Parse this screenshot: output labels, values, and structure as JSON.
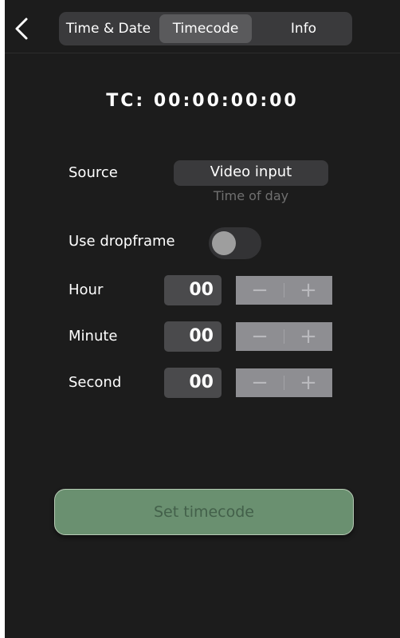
{
  "nav": {
    "back_icon": "chevron-left-icon",
    "tabs": [
      {
        "label": "Time & Date",
        "selected": false
      },
      {
        "label": "Timecode",
        "selected": true
      },
      {
        "label": "Info",
        "selected": false
      }
    ]
  },
  "timecode": {
    "prefix": "TC:",
    "value": "00:00:00:00"
  },
  "source": {
    "label": "Source",
    "options": [
      "Video input",
      "Time of day"
    ],
    "selected": "Video input"
  },
  "dropframe": {
    "label": "Use dropframe",
    "enabled": false
  },
  "fields": [
    {
      "label": "Hour",
      "value": "00",
      "minus": "−",
      "plus": "+"
    },
    {
      "label": "Minute",
      "value": "00",
      "minus": "−",
      "plus": "+"
    },
    {
      "label": "Second",
      "value": "00",
      "minus": "−",
      "plus": "+"
    }
  ],
  "action": {
    "label": "Set timecode"
  },
  "colors": {
    "background": "#1c1c1c",
    "tab_bar": "#3a3a3c",
    "tab_selected": "#5a5a5c",
    "stepper": "#8e8e92",
    "button": "#6a9070",
    "button_text": "#43604a"
  }
}
